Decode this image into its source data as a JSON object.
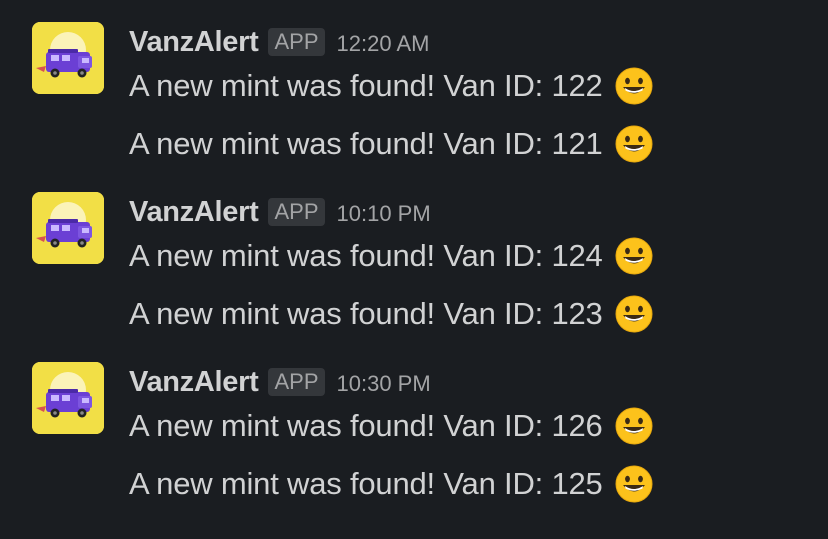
{
  "messages": [
    {
      "sender": "VanzAlert",
      "badge": "APP",
      "time": "12:20 AM",
      "lines": [
        {
          "text": "A new mint was found! Van ID: 122",
          "emoji": "grinning-face-icon"
        },
        {
          "text": "A new mint was found! Van ID: 121",
          "emoji": "grinning-face-icon"
        }
      ]
    },
    {
      "sender": "VanzAlert",
      "badge": "APP",
      "time": "10:10 PM",
      "lines": [
        {
          "text": "A new mint was found! Van ID: 124",
          "emoji": "grinning-face-icon"
        },
        {
          "text": "A new mint was found! Van ID: 123",
          "emoji": "grinning-face-icon"
        }
      ]
    },
    {
      "sender": "VanzAlert",
      "badge": "APP",
      "time": "10:30 PM",
      "lines": [
        {
          "text": "A new mint was found! Van ID: 126",
          "emoji": "grinning-face-icon"
        },
        {
          "text": "A new mint was found! Van ID: 125",
          "emoji": "grinning-face-icon"
        }
      ]
    }
  ],
  "colors": {
    "background": "#1a1d21",
    "text": "#d1d2d3",
    "muted": "#a3a4a6",
    "avatar_bg": "#f2df46",
    "van": "#6b3fd4"
  }
}
